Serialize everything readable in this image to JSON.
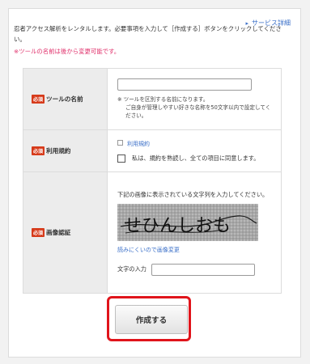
{
  "header": {
    "service_link": "サービス詳細",
    "intro": "忍者アクセス解析をレンタルします。必要事項を入力して［作成する］ボタンをクリックしてください。",
    "note": "※ツールの名前は後から変更可能です。"
  },
  "form": {
    "required_badge": "必須",
    "tool_name": {
      "label": "ツールの名前",
      "help_line1": "※ ツールを区別する名前になります。",
      "help_line2": "ご自身が管理しやすい好きな名称を50文字以内で設定してください。"
    },
    "terms": {
      "label": "利用規約",
      "link": "利用規約",
      "agree_text": "私は、規約を熟読し、全ての項目に同意します。"
    },
    "captcha": {
      "label": "画像認証",
      "description": "下記の画像に表示されている文字列を入力してください。",
      "image_text": "せひんしおも",
      "hard_to_read_link": "読みにくいので画像変更",
      "input_label": "文字の入力"
    }
  },
  "submit": {
    "label": "作成する",
    "highlight_color": "#e0141b"
  }
}
